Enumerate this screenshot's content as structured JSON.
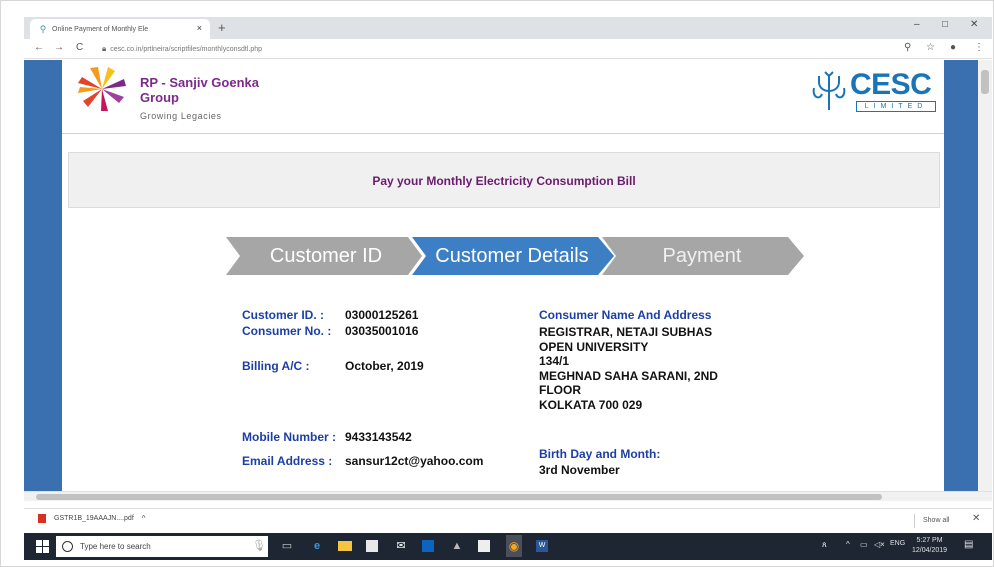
{
  "browser": {
    "tab_title": "Online Payment of Monthly Ele",
    "tab_close": "×",
    "new_tab": "+",
    "win_min": "–",
    "win_max": "□",
    "win_close": "✕",
    "back": "←",
    "forward": "→",
    "reload": "C",
    "url": "cesc.co.in/prtlneira/scriptfiles/monthlyconsdtl.php",
    "zoom_icon": "zoom-icon",
    "star_icon": "star-icon",
    "account_icon": "account-icon",
    "menu_icon": "menu-icon"
  },
  "header": {
    "rpsg_line1": "RP - Sanjiv Goenka",
    "rpsg_line2": "Group",
    "rpsg_tagline": "Growing Legacies",
    "cesc_name": "CESC",
    "cesc_limited": "LIMITED"
  },
  "title": "Pay your Monthly Electricity Consumption Bill",
  "steps": [
    {
      "label": "Customer ID",
      "active": false
    },
    {
      "label": "Customer Details",
      "active": true
    },
    {
      "label": "Payment",
      "active": false
    }
  ],
  "details": {
    "customer_id_label": "Customer ID. :",
    "customer_id_value": "03000125261",
    "consumer_no_label": "Consumer No. :",
    "consumer_no_value": "03035001016",
    "billing_label": "Billing A/C :",
    "billing_value": "October, 2019",
    "mobile_label": "Mobile Number :",
    "mobile_value": "9433143542",
    "email_label": "Email Address :",
    "email_value": "sansur12ct@yahoo.com",
    "name_addr_label": "Consumer Name And Address",
    "addr_line1": "REGISTRAR, NETAJI SUBHAS",
    "addr_line2": "OPEN UNIVERSITY",
    "addr_line3": "134/1",
    "addr_line4": "MEGHNAD SAHA SARANI, 2ND",
    "addr_line5": "FLOOR",
    "addr_line6": "KOLKATA 700 029",
    "birth_label": "Birth Day and Month:",
    "birth_value": "3rd November"
  },
  "downloads": {
    "file": "GSTR1B_19AAAJN....pdf",
    "chevron": "^",
    "show_all": "Show all",
    "close": "✕"
  },
  "taskbar": {
    "search_placeholder": "Type here to search",
    "time": "5:27 PM",
    "date": "12/04/2019",
    "lang": "ENG"
  },
  "colors": {
    "page_side": "#3a6fb0",
    "step_inactive": "#a6a6a6",
    "step_active": "#3d7fc4",
    "label_blue": "#1c3fa6",
    "title_purple": "#6a1b6e",
    "cesc_blue": "#1a74b8"
  }
}
